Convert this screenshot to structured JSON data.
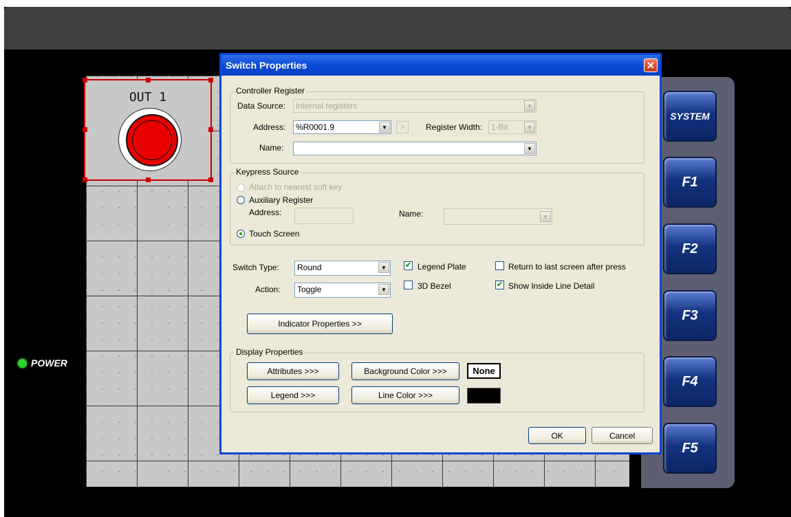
{
  "hmi": {
    "power_label": "POWER",
    "widget_label": "OUT 1",
    "fkeys": [
      "SYSTEM",
      "F1",
      "F2",
      "F3",
      "F4",
      "F5"
    ]
  },
  "dialog": {
    "title": "Switch Properties",
    "controller": {
      "group_label": "Controller Register",
      "data_source_label": "Data Source:",
      "data_source_value": "Internal registers",
      "address_label": "Address:",
      "address_value": "%R0001.9",
      "ellipsis": ">",
      "register_width_label": "Register Width:",
      "register_width_value": "1-Bit",
      "name_label": "Name:",
      "name_value": ""
    },
    "keypress": {
      "group_label": "Keypress Source",
      "attach_label": "Attach to nearest soft key",
      "aux_label": "Auxiliary Register",
      "address_label": "Address:",
      "name_label": "Name:",
      "touch_label": "Touch Screen"
    },
    "switch": {
      "type_label": "Switch Type:",
      "type_value": "Round",
      "action_label": "Action:",
      "action_value": "Toggle",
      "legend_plate_label": "Legend Plate",
      "bezel_label": "3D Bezel",
      "return_label": "Return to last screen after press",
      "inside_line_label": "Show Inside Line Detail",
      "legend_plate_checked": true,
      "bezel_checked": false,
      "return_checked": false,
      "inside_line_checked": true
    },
    "indicator_button": "Indicator Properties >>",
    "display": {
      "group_label": "Display Properties",
      "attributes_button": "Attributes >>>",
      "legend_button": "Legend >>>",
      "bg_color_button": "Background Color >>>",
      "line_color_button": "Line Color >>>",
      "bg_color_value": "None",
      "line_color": "#000000"
    },
    "ok_button": "OK",
    "cancel_button": "Cancel"
  },
  "colors": {
    "title_bar": "#0b4bd9",
    "power_led": "#2ed12e",
    "switch_red": "#e80000",
    "fkey_blue": "#13337f"
  }
}
